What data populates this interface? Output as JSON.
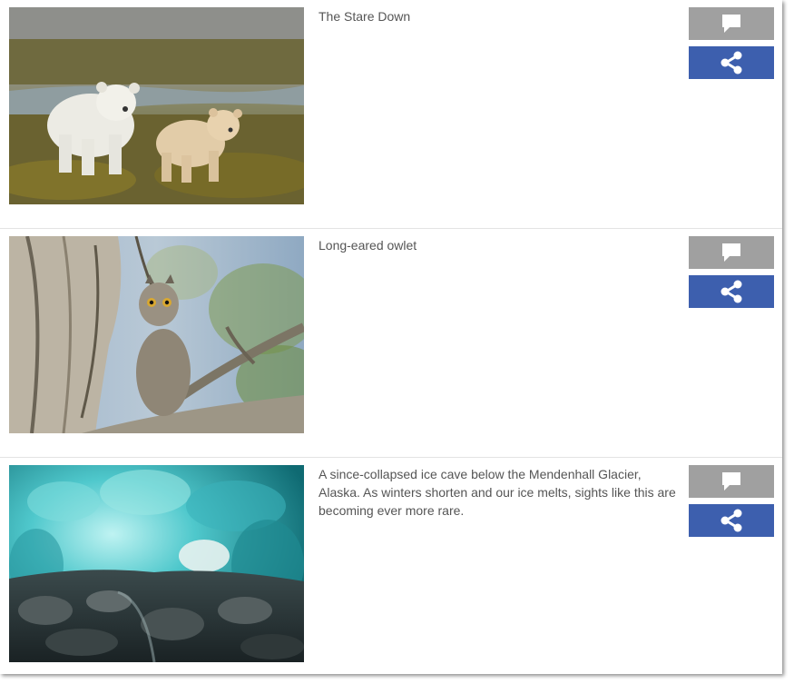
{
  "colors": {
    "comment_button": "#a0a0a0",
    "share_button": "#3d5fae",
    "caption_text": "#555555"
  },
  "items": [
    {
      "caption": "The Stare Down",
      "image": "two-spirit-bears-photo",
      "comment_icon": "speech-bubble-icon",
      "share_icon": "share-icon"
    },
    {
      "caption": "Long-eared owlet",
      "image": "owlet-on-branch-photo",
      "comment_icon": "speech-bubble-icon",
      "share_icon": "share-icon"
    },
    {
      "caption": "A since-collapsed ice cave below the Mendenhall Glacier, Alaska. As winters shorten and our ice melts, sights like this are becoming ever more rare.",
      "image": "ice-cave-photo",
      "comment_icon": "speech-bubble-icon",
      "share_icon": "share-icon"
    }
  ]
}
